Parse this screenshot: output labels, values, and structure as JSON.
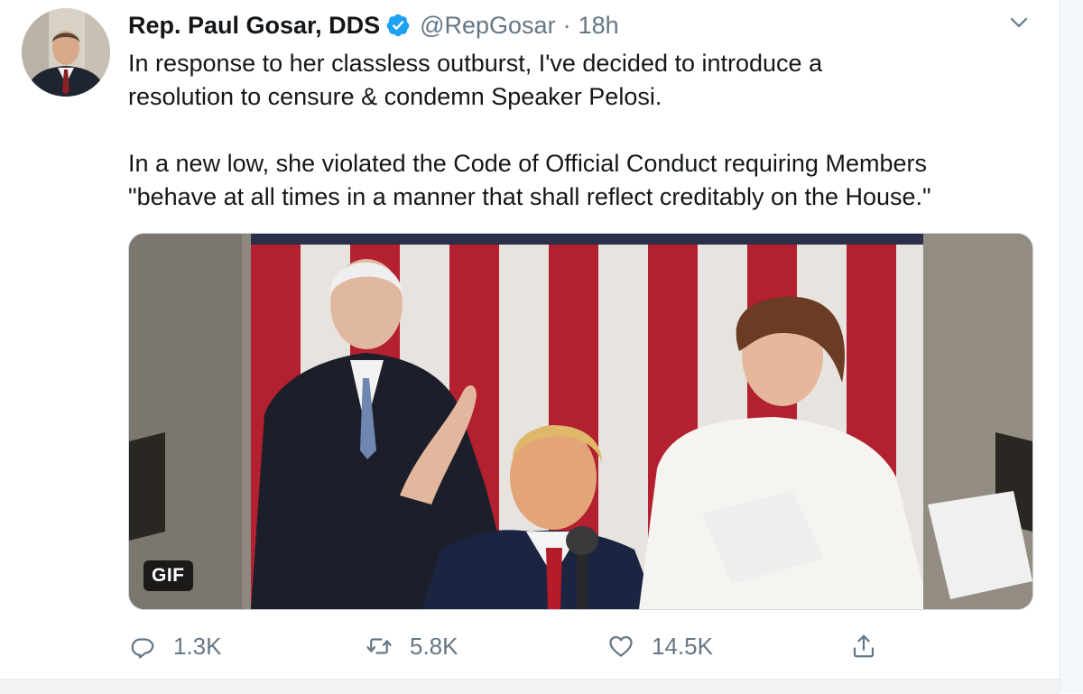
{
  "tweet": {
    "author_name": "Rep. Paul Gosar, DDS",
    "handle": "@RepGosar",
    "separator": "·",
    "time": "18h",
    "text_lines_p1": [
      "In response to her classless outburst, I've decided to introduce a",
      "resolution to censure & condemn Speaker Pelosi."
    ],
    "text_lines_p2": [
      "In a new low, she violated the Code of Official Conduct requiring Members",
      "\"behave at all times in a manner that shall reflect creditably on the House.\""
    ],
    "media": {
      "badge": "GIF"
    }
  },
  "actions": {
    "reply": {
      "icon": "reply-icon",
      "count": "1.3K"
    },
    "retweet": {
      "icon": "retweet-icon",
      "count": "5.8K"
    },
    "like": {
      "icon": "heart-icon",
      "count": "14.5K"
    },
    "share": {
      "icon": "share-icon"
    }
  },
  "icons": {
    "verified": "verified-badge-icon",
    "more": "chevron-down-icon"
  },
  "colors": {
    "text_primary": "#14171a",
    "text_secondary": "#657786",
    "verified_blue": "#1da1f2",
    "border": "#ccd6dd"
  }
}
